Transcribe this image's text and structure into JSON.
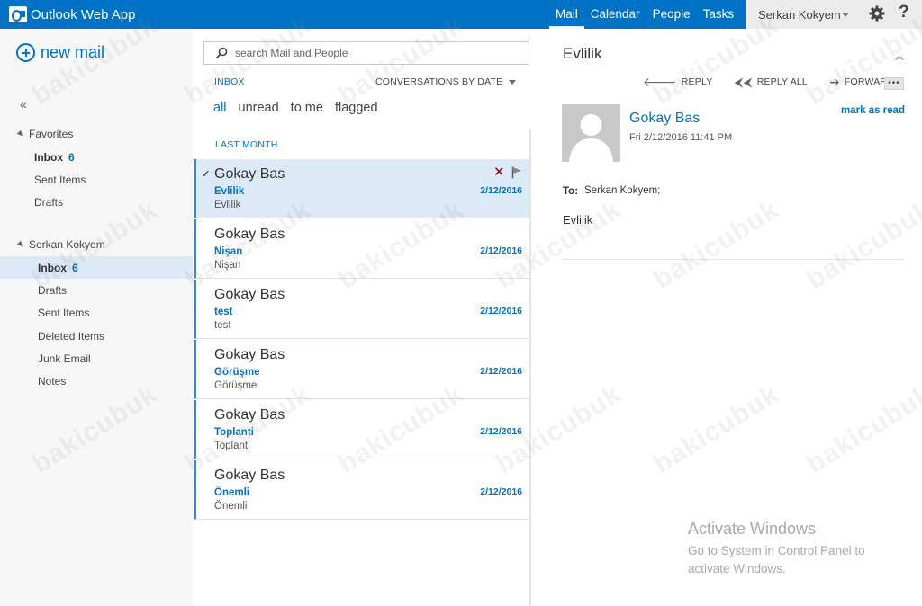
{
  "app": {
    "title": "Outlook Web App"
  },
  "topnav": [
    {
      "label": "Mail",
      "active": true
    },
    {
      "label": "Calendar",
      "active": false
    },
    {
      "label": "People",
      "active": false
    },
    {
      "label": "Tasks",
      "active": false
    }
  ],
  "user": {
    "name": "Serkan Kokyem"
  },
  "icons": {
    "settings": "gear-icon",
    "help": "help-icon",
    "help_glyph": "?"
  },
  "leftnav": {
    "new_mail": "new mail",
    "collapse_glyph": "«",
    "favorites_header": "Favorites",
    "favorites": [
      {
        "label": "Inbox",
        "count": "6"
      },
      {
        "label": "Sent Items",
        "count": ""
      },
      {
        "label": "Drafts",
        "count": ""
      }
    ],
    "account_header": "Serkan Kokyem",
    "folders": [
      {
        "label": "Inbox",
        "count": "6"
      },
      {
        "label": "Drafts",
        "count": ""
      },
      {
        "label": "Sent Items",
        "count": ""
      },
      {
        "label": "Deleted Items",
        "count": ""
      },
      {
        "label": "Junk Email",
        "count": ""
      },
      {
        "label": "Notes",
        "count": ""
      }
    ]
  },
  "search": {
    "placeholder": "search Mail and People"
  },
  "list": {
    "folder_label": "INBOX",
    "sort_label": "CONVERSATIONS BY DATE",
    "filters": [
      "all",
      "unread",
      "to me",
      "flagged"
    ],
    "group": "LAST MONTH",
    "messages": [
      {
        "sender": "Gokay Bas",
        "subject": "Evlilik",
        "preview": "Evlilik",
        "date": "2/12/2016"
      },
      {
        "sender": "Gokay Bas",
        "subject": "Nişan",
        "preview": "Nişan",
        "date": "2/12/2016"
      },
      {
        "sender": "Gokay Bas",
        "subject": "test",
        "preview": "test",
        "date": "2/12/2016"
      },
      {
        "sender": "Gokay Bas",
        "subject": "Görüşme",
        "preview": "Görüşme",
        "date": "2/12/2016"
      },
      {
        "sender": "Gokay Bas",
        "subject": "Toplanti",
        "preview": "Toplanti",
        "date": "2/12/2016"
      },
      {
        "sender": "Gokay Bas",
        "subject": "Önemli",
        "preview": "Önemli",
        "date": "2/12/2016"
      }
    ]
  },
  "reading": {
    "subject": "Evlilik",
    "actions": {
      "reply": "REPLY",
      "reply_all": "REPLY ALL",
      "forward": "FORWARD"
    },
    "more_glyph": "•••",
    "from": "Gokay Bas",
    "sent": "Fri 2/12/2016 11:41 PM",
    "mark_read": "mark as read",
    "to_label": "To:",
    "to_value": "Serkan Kokyem;",
    "body": "Evlilik"
  },
  "system_overlay": {
    "title": "Activate Windows",
    "text": "Go to System in Control Panel to activate Windows."
  },
  "watermark": "bakicubuk",
  "colors": {
    "brand": "#0072c6",
    "selected_bg": "#dce9f6",
    "unread_bar": "#2e8ad8",
    "delete": "#a80000"
  }
}
